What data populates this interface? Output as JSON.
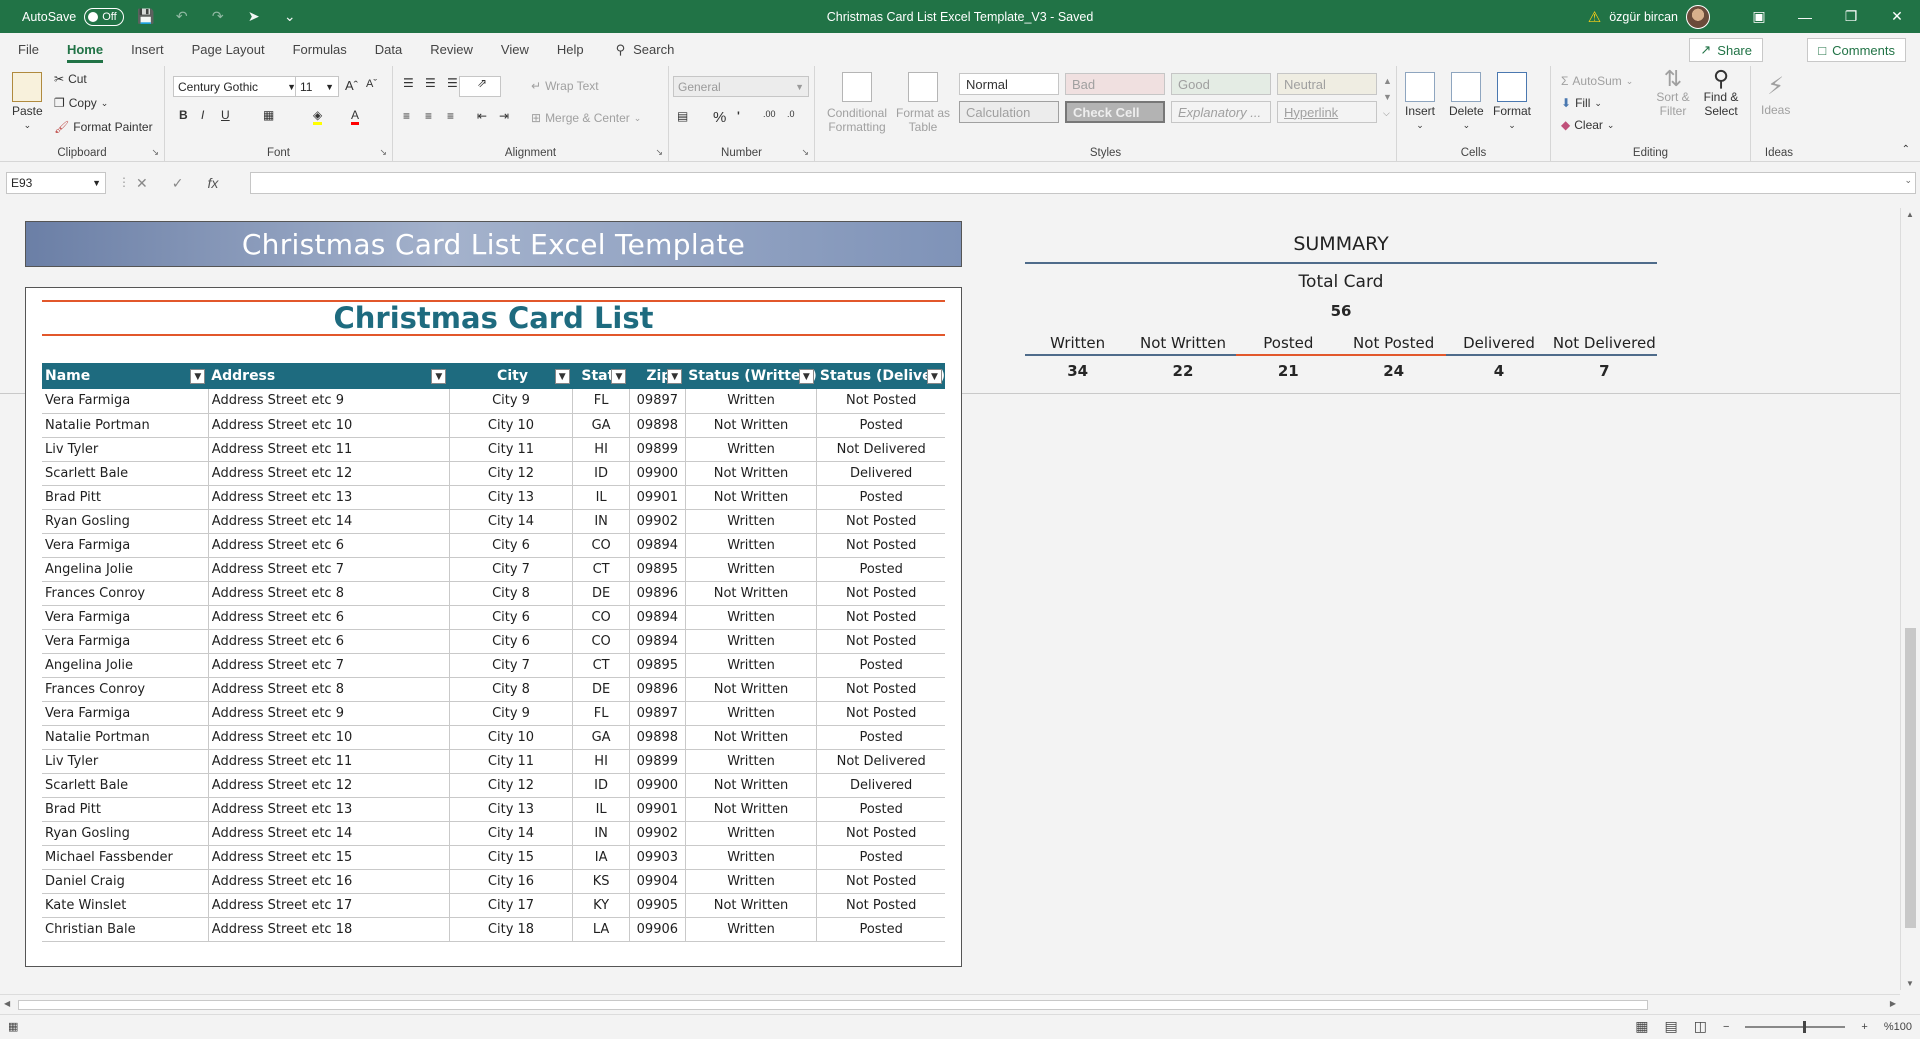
{
  "titlebar": {
    "autosave_label": "AutoSave",
    "autosave_state": "Off",
    "document_title": "Christmas Card List Excel Template_V3  -  Saved",
    "user_name": "özgür bircan"
  },
  "menu": {
    "tabs": [
      "File",
      "Home",
      "Insert",
      "Page Layout",
      "Formulas",
      "Data",
      "Review",
      "View",
      "Help"
    ],
    "active_tab": "Home",
    "search_label": "Search",
    "share_label": "Share",
    "comments_label": "Comments"
  },
  "ribbon": {
    "clipboard": {
      "paste": "Paste",
      "cut": "Cut",
      "copy": "Copy",
      "format_painter": "Format Painter",
      "label": "Clipboard"
    },
    "font": {
      "name": "Century Gothic",
      "size": "11",
      "label": "Font"
    },
    "alignment": {
      "wrap": "Wrap Text",
      "merge": "Merge & Center",
      "label": "Alignment"
    },
    "number": {
      "format": "General",
      "label": "Number"
    },
    "styles": {
      "conditional": "Conditional Formatting",
      "format_table": "Format as Table",
      "cells": [
        "Normal",
        "Bad",
        "Good",
        "Neutral",
        "Calculation",
        "Check Cell",
        "Explanatory ...",
        "Hyperlink"
      ],
      "label": "Styles"
    },
    "cells": {
      "insert": "Insert",
      "delete": "Delete",
      "format": "Format",
      "label": "Cells"
    },
    "editing": {
      "autosum": "AutoSum",
      "fill": "Fill",
      "clear": "Clear",
      "sort": "Sort & Filter",
      "find": "Find & Select",
      "label": "Editing"
    },
    "ideas": {
      "button": "Ideas",
      "label": "Ideas"
    }
  },
  "formula_bar": {
    "name_box": "E93",
    "fx": "fx",
    "content": ""
  },
  "sheet": {
    "banner": "Christmas Card List Excel Template",
    "list_title": "Christmas Card List",
    "columns": [
      "Name",
      "Address",
      "City",
      "State",
      "Zip",
      "Status (Written)",
      "Status (Deliver)"
    ],
    "rows": [
      [
        "Vera Farmiga",
        "Address Street etc 9",
        "City 9",
        "FL",
        "09897",
        "Written",
        "Not Posted"
      ],
      [
        "Natalie Portman",
        "Address Street etc 10",
        "City 10",
        "GA",
        "09898",
        "Not Written",
        "Posted"
      ],
      [
        "Liv Tyler",
        "Address Street etc 11",
        "City 11",
        "HI",
        "09899",
        "Written",
        "Not Delivered"
      ],
      [
        "Scarlett Bale",
        "Address Street etc 12",
        "City 12",
        "ID",
        "09900",
        "Not Written",
        "Delivered"
      ],
      [
        "Brad Pitt",
        "Address Street etc 13",
        "City 13",
        "IL",
        "09901",
        "Not Written",
        "Posted"
      ],
      [
        "Ryan Gosling",
        "Address Street etc 14",
        "City 14",
        "IN",
        "09902",
        "Written",
        "Not Posted"
      ],
      [
        "Vera Farmiga",
        "Address Street etc 6",
        "City 6",
        "CO",
        "09894",
        "Written",
        "Not Posted"
      ],
      [
        "Angelina Jolie",
        "Address Street etc 7",
        "City 7",
        "CT",
        "09895",
        "Written",
        "Posted"
      ],
      [
        "Frances Conroy",
        "Address Street etc 8",
        "City 8",
        "DE",
        "09896",
        "Not Written",
        "Not Posted"
      ],
      [
        "Vera Farmiga",
        "Address Street etc 6",
        "City 6",
        "CO",
        "09894",
        "Written",
        "Not Posted"
      ],
      [
        "Vera Farmiga",
        "Address Street etc 6",
        "City 6",
        "CO",
        "09894",
        "Written",
        "Not Posted"
      ],
      [
        "Angelina Jolie",
        "Address Street etc 7",
        "City 7",
        "CT",
        "09895",
        "Written",
        "Posted"
      ],
      [
        "Frances Conroy",
        "Address Street etc 8",
        "City 8",
        "DE",
        "09896",
        "Not Written",
        "Not Posted"
      ],
      [
        "Vera Farmiga",
        "Address Street etc 9",
        "City 9",
        "FL",
        "09897",
        "Written",
        "Not Posted"
      ],
      [
        "Natalie Portman",
        "Address Street etc 10",
        "City 10",
        "GA",
        "09898",
        "Not Written",
        "Posted"
      ],
      [
        "Liv Tyler",
        "Address Street etc 11",
        "City 11",
        "HI",
        "09899",
        "Written",
        "Not Delivered"
      ],
      [
        "Scarlett Bale",
        "Address Street etc 12",
        "City 12",
        "ID",
        "09900",
        "Not Written",
        "Delivered"
      ],
      [
        "Brad Pitt",
        "Address Street etc 13",
        "City 13",
        "IL",
        "09901",
        "Not Written",
        "Posted"
      ],
      [
        "Ryan Gosling",
        "Address Street etc 14",
        "City 14",
        "IN",
        "09902",
        "Written",
        "Not Posted"
      ],
      [
        "Michael Fassbender",
        "Address Street etc 15",
        "City 15",
        "IA",
        "09903",
        "Written",
        "Posted"
      ],
      [
        "Daniel Craig",
        "Address Street etc 16",
        "City 16",
        "KS",
        "09904",
        "Written",
        "Not Posted"
      ],
      [
        "Kate Winslet",
        "Address Street etc 17",
        "City 17",
        "KY",
        "09905",
        "Not Written",
        "Not Posted"
      ],
      [
        "Christian Bale",
        "Address Street etc 18",
        "City 18",
        "LA",
        "09906",
        "Written",
        "Posted"
      ]
    ]
  },
  "summary": {
    "title": "SUMMARY",
    "total_label": "Total Card",
    "total_value": "56",
    "stats": [
      {
        "label": "Written",
        "value": "34"
      },
      {
        "label": "Not Written",
        "value": "22"
      },
      {
        "label": "Posted",
        "value": "21"
      },
      {
        "label": "Not Posted",
        "value": "24"
      },
      {
        "label": "Delivered",
        "value": "4"
      },
      {
        "label": "Not Delivered",
        "value": "7"
      }
    ]
  },
  "statusbar": {
    "zoom": "%100"
  },
  "colors": {
    "excel_green": "#217346",
    "header_teal": "#1e6b7f",
    "accent_orange": "#e2572b"
  }
}
